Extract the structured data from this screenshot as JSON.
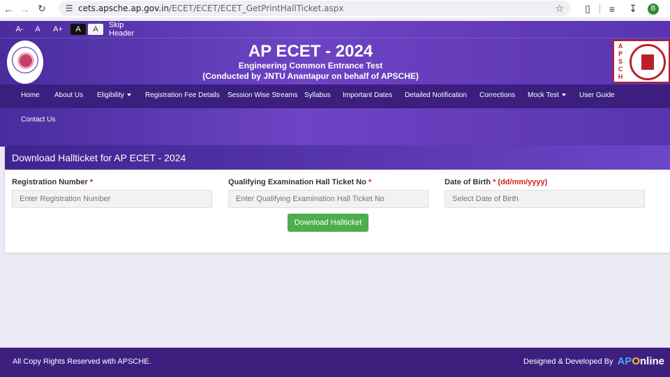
{
  "browser": {
    "url_host": "cets.apsche.ap.gov.in",
    "url_path": "/ECET/ECET/ECET_GetPrintHallTicket.aspx",
    "profile_initial": "B"
  },
  "accessibility": {
    "decrease": "A-",
    "normal": "A",
    "increase": "A+",
    "dark": "A",
    "light": "A",
    "skip": "Skip Header"
  },
  "header": {
    "title": "AP ECET - 2024",
    "subtitle": "Engineering Common Entrance Test",
    "conducted_by": "(Conducted by JNTU Anantapur on behalf of APSCHE)",
    "right_logo_text": "APSCHE"
  },
  "menu": [
    {
      "label": "Home"
    },
    {
      "label": "About Us"
    },
    {
      "label": "Eligibility"
    },
    {
      "label": "Registration Fee Details"
    },
    {
      "label": "Session Wise Streams"
    },
    {
      "label": "Syllabus"
    },
    {
      "label": "Important Dates"
    },
    {
      "label": "Detailed Notification"
    },
    {
      "label": "Corrections"
    },
    {
      "label": "Mock Test"
    },
    {
      "label": "User Guide"
    },
    {
      "label": "Contact Us"
    }
  ],
  "form": {
    "heading": "Download Hallticket for AP ECET - 2024",
    "reg_label": "Registration Number",
    "reg_placeholder": "Enter Registration Number",
    "qual_label": "Qualifying Examination Hall Ticket No",
    "qual_placeholder": "Enter Qualifying Examination Hall Ticket No",
    "dob_label": "Date of Birth",
    "dob_format": "(dd/mm/yyyy)",
    "dob_placeholder": "Select Date of Birth",
    "required_mark": "*",
    "button": "Download Hallticket"
  },
  "footer": {
    "copyright": "All Copy Rights Reserved with APSCHE.",
    "designed": "Designed & Developed By",
    "logo_ap": "AP",
    "logo_o": "O",
    "logo_rest": "nline"
  },
  "colors": {
    "header_purple": "#5a34b0",
    "menubar": "#3a1f7e",
    "button_green": "#4cae4c",
    "required_red": "#d52020"
  }
}
